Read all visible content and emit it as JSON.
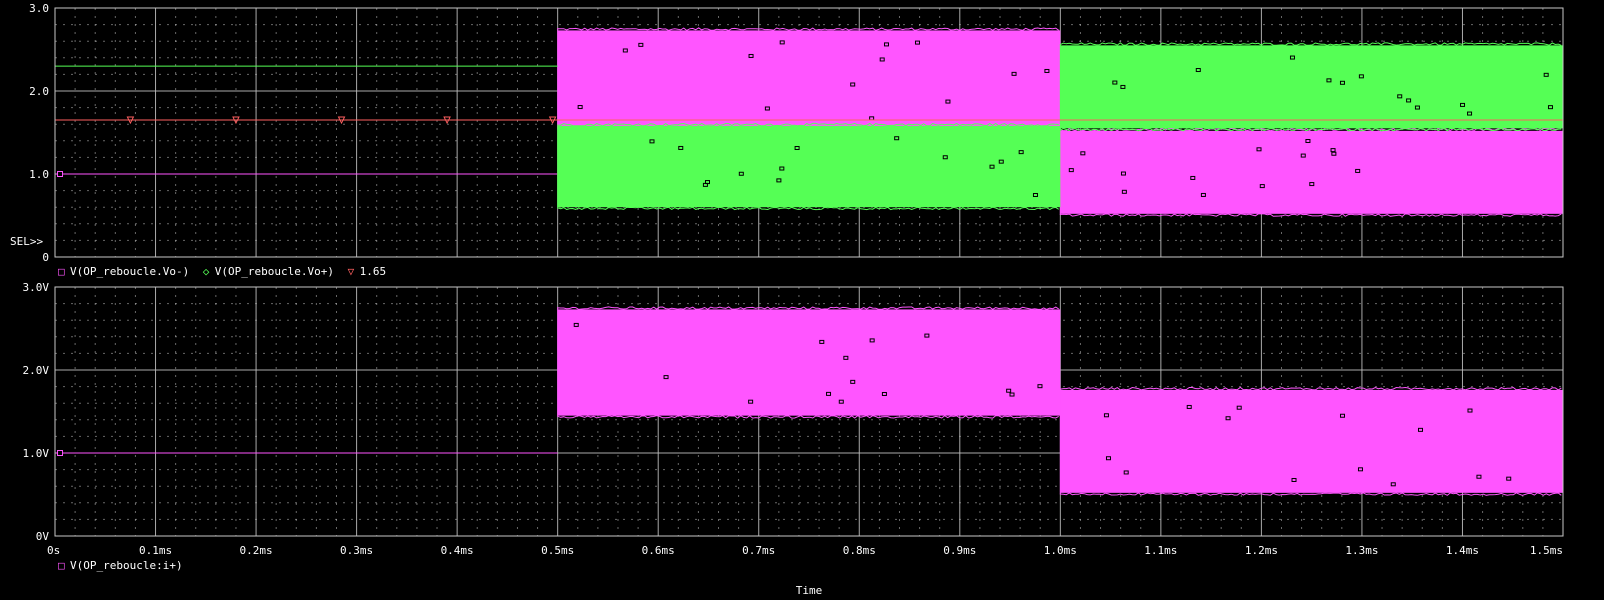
{
  "colors": {
    "background": "#000000",
    "frame": "#c8c8c8",
    "grid": "#bdbdbd",
    "text": "#ffffff",
    "magenta": "#ff55ff",
    "green": "#55ff55",
    "ref_red": "#ff6060",
    "flat_green": "#55ff55"
  },
  "x_axis": {
    "label": "Time",
    "unit": "ms",
    "range": [
      0,
      1.5
    ],
    "ticks": [
      "0s",
      "0.1ms",
      "0.2ms",
      "0.3ms",
      "0.4ms",
      "0.5ms",
      "0.6ms",
      "0.7ms",
      "0.8ms",
      "0.9ms",
      "1.0ms",
      "1.1ms",
      "1.2ms",
      "1.3ms",
      "1.4ms",
      "1.5ms"
    ]
  },
  "chart_data": [
    {
      "type": "line",
      "plot": "top",
      "ylim": [
        0,
        3.0
      ],
      "y_ticks": [
        "0",
        "1.0",
        "2.0",
        "3.0"
      ],
      "selection_marker": "SEL>>",
      "legend": [
        {
          "symbol": "□",
          "text": "V(OP_reboucle.Vo-)",
          "color": "#ff55ff"
        },
        {
          "symbol": "◇",
          "text": "V(OP_reboucle.Vo+)",
          "color": "#55ff55"
        },
        {
          "symbol": "▽",
          "text": "1.65",
          "color": "#ff6060"
        }
      ],
      "series": [
        {
          "name": "V(OP_reboucle.Vo-)",
          "color": "#ff55ff",
          "segments": [
            {
              "t": [
                0,
                0.5
              ],
              "kind": "flat",
              "value": 1.0
            },
            {
              "t": [
                0.5,
                1.0
              ],
              "kind": "band",
              "min": 1.55,
              "max": 2.73
            },
            {
              "t": [
                1.0,
                1.5
              ],
              "kind": "band",
              "min": 0.52,
              "max": 1.52
            }
          ]
        },
        {
          "name": "V(OP_reboucle.Vo+)",
          "color": "#55ff55",
          "segments": [
            {
              "t": [
                0,
                0.5
              ],
              "kind": "flat",
              "value": 2.3
            },
            {
              "t": [
                0.5,
                1.0
              ],
              "kind": "band",
              "min": 0.6,
              "max": 1.58
            },
            {
              "t": [
                1.0,
                1.5
              ],
              "kind": "band",
              "min": 1.55,
              "max": 2.55
            }
          ]
        },
        {
          "name": "1.65",
          "color": "#ff6060",
          "segments": [
            {
              "t": [
                0,
                1.5
              ],
              "kind": "flat",
              "value": 1.65
            }
          ]
        }
      ]
    },
    {
      "type": "line",
      "plot": "bottom",
      "ylim": [
        0,
        3.0
      ],
      "y_ticks": [
        "0V",
        "1.0V",
        "2.0V",
        "3.0V"
      ],
      "legend": [
        {
          "symbol": "□",
          "text": "V(OP_reboucle:i+)",
          "color": "#ff55ff"
        }
      ],
      "series": [
        {
          "name": "V(OP_reboucle:i+)",
          "color": "#ff55ff",
          "segments": [
            {
              "t": [
                0,
                0.5
              ],
              "kind": "flat",
              "value": 1.0
            },
            {
              "t": [
                0.5,
                1.0
              ],
              "kind": "band",
              "min": 1.45,
              "max": 2.73
            },
            {
              "t": [
                1.0,
                1.5
              ],
              "kind": "band",
              "min": 0.52,
              "max": 1.76
            }
          ]
        }
      ]
    }
  ]
}
